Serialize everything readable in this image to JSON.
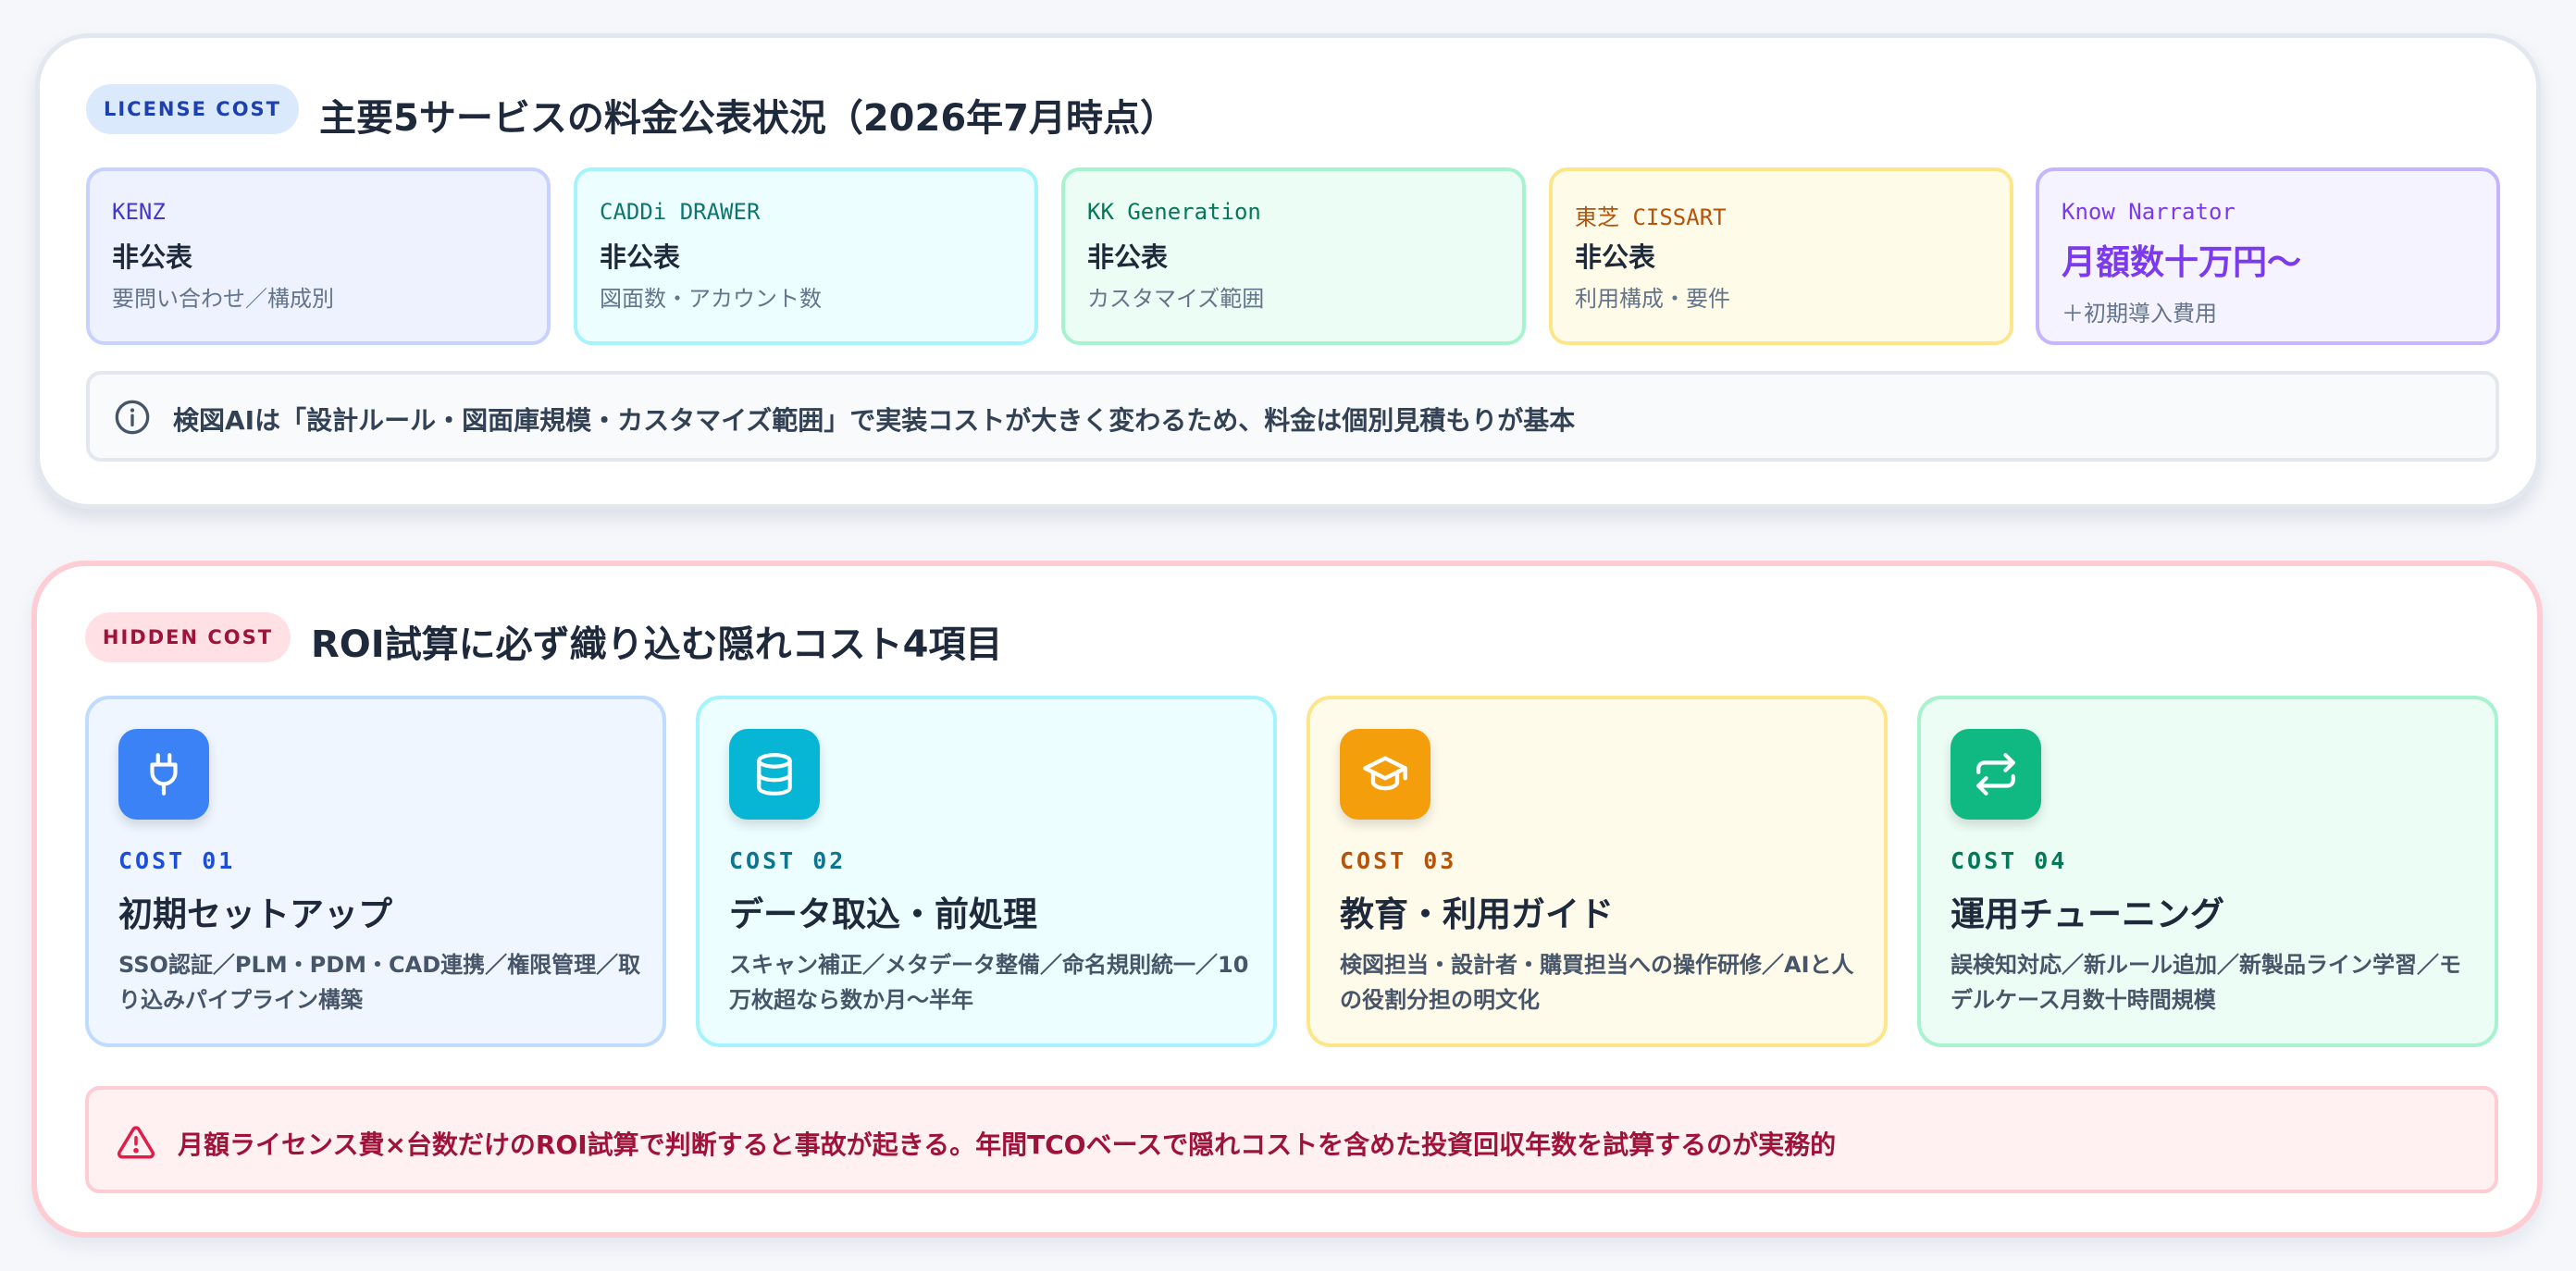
{
  "license": {
    "badge": "LICENSE COST",
    "title": "主要5サービスの料金公表状況（2026年7月時点）",
    "services": [
      {
        "name": "KENZ",
        "status": "非公表",
        "note": "要問い合わせ／構成別",
        "name_color": "#4338ca",
        "bg": "#eef2ff",
        "border": "#c7d2fe"
      },
      {
        "name": "CADDi DRAWER",
        "status": "非公表",
        "note": "図面数・アカウント数",
        "name_color": "#0f766e",
        "bg": "#ecfeff",
        "border": "#a5f3fc"
      },
      {
        "name": "KK Generation",
        "status": "非公表",
        "note": "カスタマイズ範囲",
        "name_color": "#047857",
        "bg": "#ecfdf5",
        "border": "#a7f3d0"
      },
      {
        "name": "東芝 CISSART",
        "status": "非公表",
        "note": "利用構成・要件",
        "name_color": "#b45309",
        "bg": "#fefce8",
        "border": "#fde68a"
      },
      {
        "name": "Know Narrator",
        "status": "月額数十万円〜",
        "note": "＋初期導入費用",
        "name_color": "#7c3aed",
        "bg": "#f5f3ff",
        "border": "#c4b5fd"
      }
    ],
    "info": "検図AIは「設計ルール・図面庫規模・カスタマイズ範囲」で実装コストが大きく変わるため、料金は個別見積もりが基本"
  },
  "hidden": {
    "badge": "HIDDEN COST",
    "title": "ROI試算に必ず織り込む隠れコスト4項目",
    "costs": [
      {
        "code": "COST 01",
        "title": "初期セットアップ",
        "desc": "SSO認証／PLM・PDM・CAD連携／権限管理／取り込みパイプライン構築",
        "icon": "plug-icon",
        "icon_bg": "#3b82f6",
        "code_color": "#1d4ed8",
        "bg": "#eff6ff",
        "border": "#bfdbfe"
      },
      {
        "code": "COST 02",
        "title": "データ取込・前処理",
        "desc": "スキャン補正／メタデータ整備／命名規則統一／10万枚超なら数か月〜半年",
        "icon": "database-icon",
        "icon_bg": "#06b6d4",
        "code_color": "#0e7490",
        "bg": "#ecfeff",
        "border": "#a5f3fc"
      },
      {
        "code": "COST 03",
        "title": "教育・利用ガイド",
        "desc": "検図担当・設計者・購買担当への操作研修／AIと人の役割分担の明文化",
        "icon": "graduation-cap-icon",
        "icon_bg": "#f59e0b",
        "code_color": "#b45309",
        "bg": "#fffbeb",
        "border": "#fde68a"
      },
      {
        "code": "COST 04",
        "title": "運用チューニング",
        "desc": "誤検知対応／新ルール追加／新製品ライン学習／モデルケース月数十時間規模",
        "icon": "repeat-icon",
        "icon_bg": "#10b981",
        "code_color": "#047857",
        "bg": "#ecfdf5",
        "border": "#a7f3d0"
      }
    ],
    "warning": "月額ライセンス費×台数だけのROI試算で判断すると事故が起きる。年間TCOベースで隠れコストを含めた投資回収年数を試算するのが実務的"
  }
}
